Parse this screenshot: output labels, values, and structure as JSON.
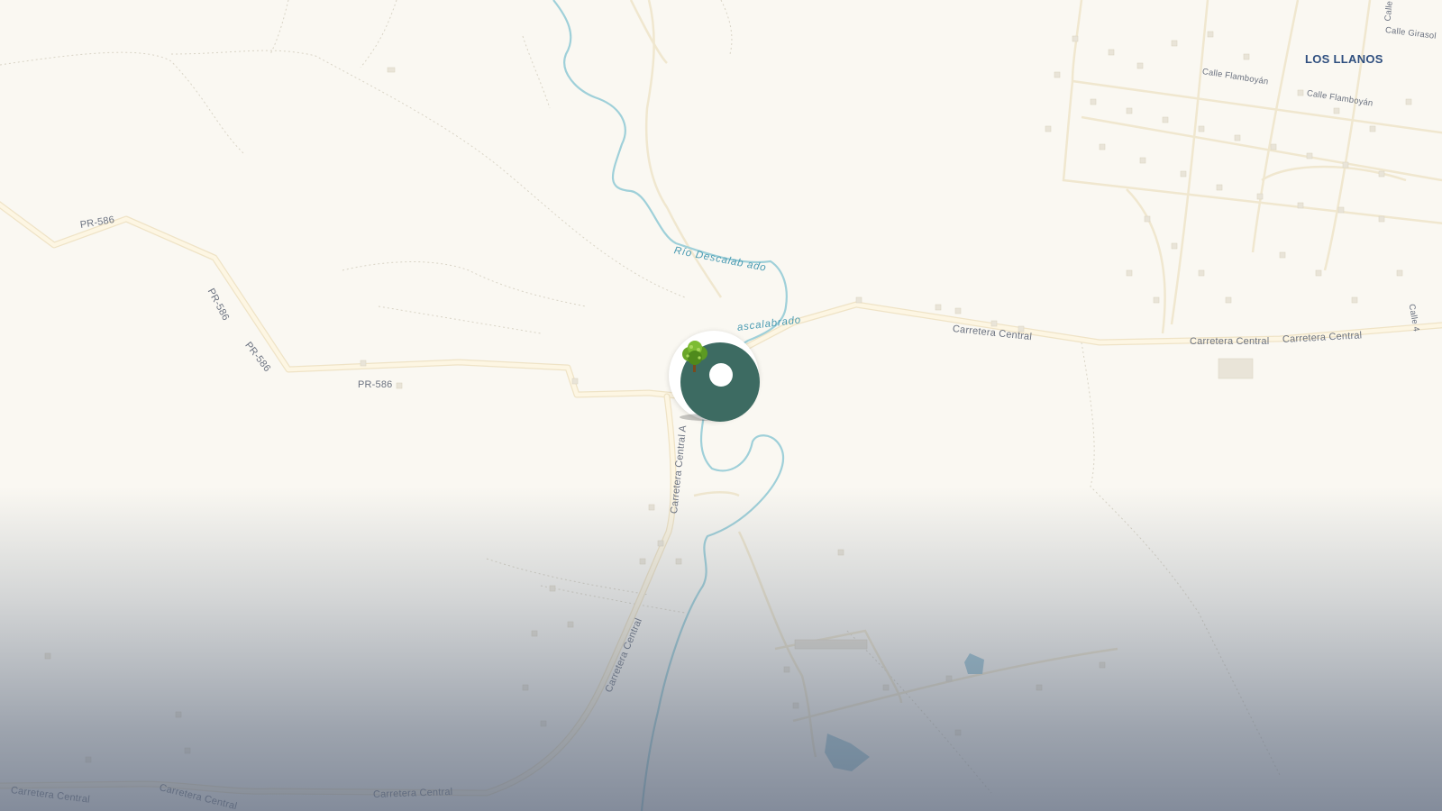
{
  "map": {
    "town_labels": [
      "LOS LLANOS"
    ],
    "road_labels": [
      "PR-586",
      "PR-586",
      "PR-586",
      "PR-586",
      "Carretera Central",
      "Carretera Central",
      "Carretera Central",
      "Carretera Central A",
      "Carretera Central",
      "Carretera Central",
      "Carretera Central",
      "Carretera Central"
    ],
    "street_labels": [
      "Calle Flamboyán",
      "Calle Flamboyán",
      "Calle Girasol",
      "Calle",
      "Calle 4"
    ],
    "river_labels": [
      "Río Descalab ado",
      "ascalabrado"
    ],
    "colors": {
      "land": "#faf8f2",
      "road_fill": "#fdf6e3",
      "road_casing": "#efe3c6",
      "river": "#9fd0d9",
      "building": "#ece8dd",
      "water_body": "#9fc6d4",
      "marker_disc": "#3d6b62",
      "town_label": "#2f4f7f"
    },
    "marker": {
      "icon": "tree-icon"
    }
  }
}
